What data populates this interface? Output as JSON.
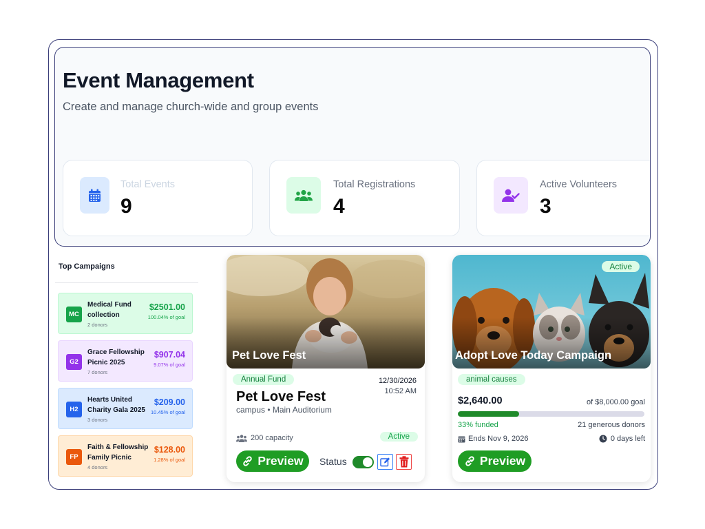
{
  "header": {
    "title": "Event Management",
    "subtitle": "Create and manage church-wide and group events"
  },
  "stats": [
    {
      "label": "Total Events",
      "value": "9",
      "icon": "calendar-icon",
      "color": "#2563eb"
    },
    {
      "label": "Total Registrations",
      "value": "4",
      "icon": "users-icon",
      "color": "#16a34a"
    },
    {
      "label": "Active Volunteers",
      "value": "3",
      "icon": "user-check-icon",
      "color": "#9333ea"
    }
  ],
  "top_campaigns": {
    "title": "Top Campaigns",
    "items": [
      {
        "badge": "MC",
        "name": "Medical Fund collection",
        "donors": "2 donors",
        "amount": "$2501.00",
        "goal": "100.04% of goal",
        "color": "#16a34a"
      },
      {
        "badge": "G2",
        "name": "Grace Fellowship Picnic 2025",
        "donors": "7 donors",
        "amount": "$907.04",
        "goal": "9.07% of goal",
        "color": "#9333ea"
      },
      {
        "badge": "H2",
        "name": "Hearts United Charity Gala 2025",
        "donors": "3 donors",
        "amount": "$209.00",
        "goal": "10.45% of goal",
        "color": "#2563eb"
      },
      {
        "badge": "FP",
        "name": "Faith & Fellowship Family Picnic",
        "donors": "4 donors",
        "amount": "$128.00",
        "goal": "1.28% of goal",
        "color": "#ea580c"
      }
    ]
  },
  "event_card": {
    "image_caption": "Pet Love Fest",
    "category": "Annual Fund",
    "date": "12/30/2026",
    "time": "10:52 AM",
    "title": "Pet Love Fest",
    "location": "campus • Main Auditorium",
    "capacity": "200 capacity",
    "status": "Active",
    "preview_label": "Preview",
    "status_label": "Status",
    "status_toggle_on": true
  },
  "campaign_card": {
    "status": "Active",
    "image_caption": "Adopt Love Today Campaign",
    "category": "animal causes",
    "raised": "$2,640.00",
    "goal": "of $8,000.00 goal",
    "funded_fraction": 0.33,
    "funded_label": "33% funded",
    "donors": "21 generous donors",
    "ends": "Ends Nov 9, 2026",
    "days_left": "0 days left",
    "preview_label": "Preview"
  },
  "colors": {
    "accent_green": "#1f9d24",
    "frame_border": "#3b3f7a"
  }
}
